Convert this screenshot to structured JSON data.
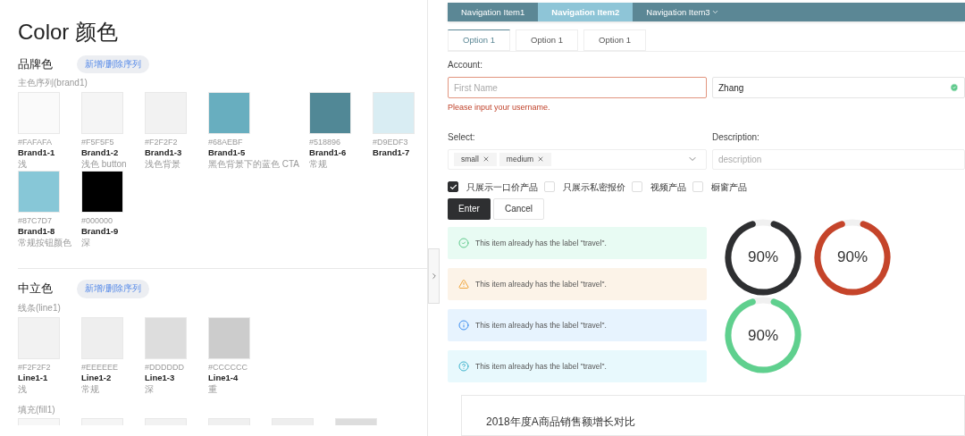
{
  "left": {
    "title": "Color 颜色",
    "sections": [
      {
        "heading": "品牌色",
        "action": "新增/删除序列",
        "series_label": "主色序列(brand1)",
        "swatches": [
          {
            "color": "#fafafa",
            "hex": "#FAFAFA",
            "name": "Brand1-1",
            "note": "浅"
          },
          {
            "color": "#f5f5f5",
            "hex": "#F5F5F5",
            "name": "Brand1-2",
            "note": "浅色 button"
          },
          {
            "color": "#f2f2f2",
            "hex": "#F2F2F2",
            "name": "Brand1-3",
            "note": "浅色背景"
          },
          {
            "color": "#68aebf",
            "hex": "#68AEBF",
            "name": "Brand1-5",
            "note": "黑色背景下的蓝色 CTA"
          },
          {
            "color": "#518896",
            "hex": "#518896",
            "name": "Brand1-6",
            "note": "常规"
          },
          {
            "color": "#d9edf3",
            "hex": "#D9EDF3",
            "name": "Brand1-7"
          },
          {
            "color": "#87c7d7",
            "hex": "#87C7D7",
            "name": "Brand1-8",
            "note": "常规按钮颜色"
          },
          {
            "color": "#000000",
            "hex": "#000000",
            "name": "Brand1-9",
            "note": "深"
          }
        ]
      },
      {
        "heading": "中立色",
        "action": "新增/删除序列",
        "series_label": "线条(line1)",
        "swatches": [
          {
            "color": "#f2f2f2",
            "hex": "#F2F2F2",
            "name": "Line1-1",
            "note": "浅"
          },
          {
            "color": "#eeeeee",
            "hex": "#EEEEEE",
            "name": "Line1-2",
            "note": "常规"
          },
          {
            "color": "#dddddd",
            "hex": "#DDDDDD",
            "name": "Line1-3",
            "note": "深"
          },
          {
            "color": "#cccccc",
            "hex": "#CCCCCC",
            "name": "Line1-4",
            "note": "重"
          }
        ]
      }
    ],
    "fill_label": "填充(fill1)",
    "fill_swatches": [
      {
        "color": "#f7f7f7"
      },
      {
        "color": "#f5f5f5"
      },
      {
        "color": "#f2f2f2"
      },
      {
        "color": "#f0f0f0"
      },
      {
        "color": "#eeeeee"
      },
      {
        "color": "#dddddd"
      }
    ]
  },
  "nav": [
    {
      "label": "Navigation Item1",
      "selected": false
    },
    {
      "label": "Navigation Item2",
      "selected": true
    },
    {
      "label": "Navigation Item3",
      "selected": false,
      "dropdown": true
    }
  ],
  "tabs": [
    {
      "label": "Option 1",
      "selected": true
    },
    {
      "label": "Option 1",
      "selected": false
    },
    {
      "label": "Option 1",
      "selected": false
    }
  ],
  "form": {
    "account_label": "Account:",
    "first_name": {
      "placeholder": "First Name",
      "error": true
    },
    "last_name": {
      "value": "Zhang",
      "valid": true
    },
    "error_text": "Please input your username.",
    "select_label": "Select:",
    "select_tags": [
      "small",
      "medium"
    ],
    "description_label": "Description:",
    "description": {
      "placeholder": "description"
    },
    "checkboxes": [
      {
        "label": "只展示一口价产品",
        "checked": true
      },
      {
        "label": "只展示私密报价",
        "checked": false
      },
      {
        "label": "视频产品",
        "checked": false
      },
      {
        "label": "橱窗产品",
        "checked": false
      }
    ],
    "buttons": [
      {
        "label": "Enter",
        "kind": "primary"
      },
      {
        "label": "Cancel",
        "kind": "default"
      }
    ]
  },
  "alerts": [
    {
      "kind": "success",
      "text": "This item already has the label \"travel\"."
    },
    {
      "kind": "warning",
      "text": "This item already has the label \"travel\"."
    },
    {
      "kind": "info",
      "text": "This item already has the label \"travel\"."
    },
    {
      "kind": "help",
      "text": "This item already has the label \"travel\"."
    }
  ],
  "progress": [
    {
      "level": 0.9,
      "reading": "90%",
      "color": "#2e2f31"
    },
    {
      "level": 0.9,
      "reading": "90%",
      "color": "#c5442a"
    },
    {
      "level": 0.9,
      "reading": "90%",
      "color": "#5fd08e"
    }
  ],
  "chart_card": {
    "title": "2018年度A商品销售额增长对比"
  }
}
